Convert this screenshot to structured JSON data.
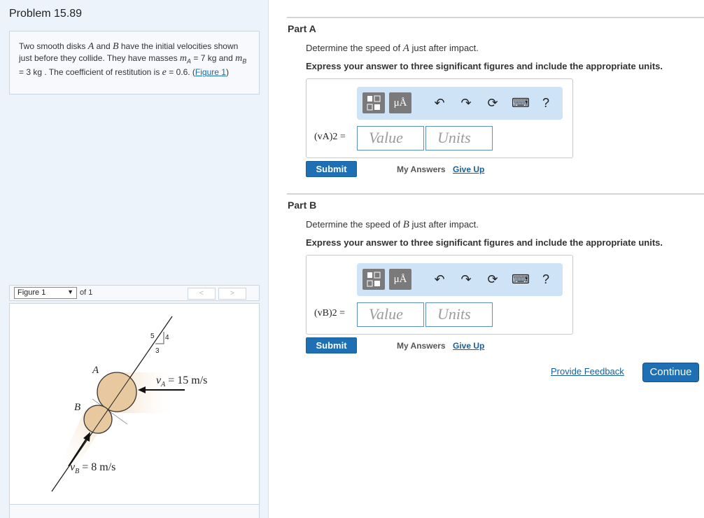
{
  "problem": {
    "title": "Problem 15.89",
    "text_1": "Two smooth disks ",
    "disk_a": "A",
    "text_2": " and ",
    "disk_b": "B",
    "text_3": " have the initial velocities shown just before they collide. They have masses ",
    "mass_a_sym": "m",
    "mass_a_sub": "A",
    "text_4": " = 7  kg and ",
    "mass_b_sym": "m",
    "mass_b_sub": "B",
    "text_5": " = 3  kg . The coefficient of restitution is ",
    "e_sym": "e",
    "text_6": " = 0.6. (",
    "figure_link": "Figure 1",
    "text_7": ")"
  },
  "figure_nav": {
    "selected": "Figure 1",
    "of_label": "of 1",
    "prev": "<",
    "next": ">"
  },
  "figure": {
    "label_a": "A",
    "label_b": "B",
    "slope_5": "5",
    "slope_4": "4",
    "slope_3": "3",
    "va_label": "v",
    "va_sub": "A",
    "va_value": " = 15 m/s",
    "vb_label": "v",
    "vb_sub": "B",
    "vb_value": " = 8 m/s"
  },
  "toolbar": {
    "templates_icon": "templates-icon",
    "units_label": "μÅ",
    "undo": "↶",
    "redo": "↷",
    "reset": "⟳",
    "keyboard": "⌨",
    "help": "?"
  },
  "part_a": {
    "title": "Part A",
    "question_1": "Determine the speed of ",
    "question_var": "A",
    "question_2": " just after impact.",
    "instruction": "Express your answer to three significant figures and include the appropriate units.",
    "var_label": "(vA)2 =",
    "value_placeholder": "Value",
    "units_placeholder": "Units",
    "submit": "Submit",
    "my_answers": "My Answers",
    "give_up": "Give Up"
  },
  "part_b": {
    "title": "Part B",
    "question_1": "Determine the speed of ",
    "question_var": "B",
    "question_2": " just after impact.",
    "instruction": "Express your answer to three significant figures and include the appropriate units.",
    "var_label": "(vB)2 =",
    "value_placeholder": "Value",
    "units_placeholder": "Units",
    "submit": "Submit",
    "my_answers": "My Answers",
    "give_up": "Give Up"
  },
  "footer": {
    "feedback": "Provide Feedback",
    "continue": "Continue"
  }
}
